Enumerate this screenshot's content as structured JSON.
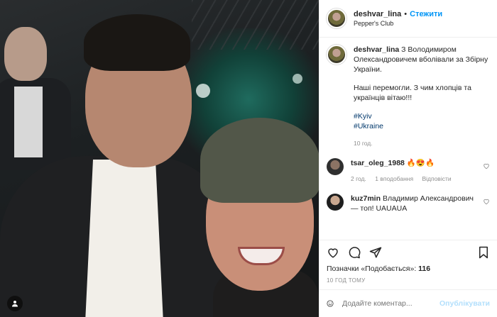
{
  "header": {
    "username": "deshvar_lina",
    "separator": "•",
    "follow_label": "Стежити",
    "location": "Pepper's Club"
  },
  "caption": {
    "username": "deshvar_lina",
    "text1": "З Володимиром Олександровичем вболівали за Збірну України.",
    "text2": "Наші перемогли. З чим хлопців та українців вітаю!!!",
    "hashtags": [
      "#Kyiv",
      "#Ukraine"
    ],
    "time": "10 год."
  },
  "comments": [
    {
      "username": "tsar_oleg_1988",
      "text": "🔥😍🔥",
      "time": "2 год.",
      "likes": "1 вподобання",
      "reply_label": "Відповісти"
    },
    {
      "username": "kuz7min",
      "text": "Владимир Александрович — топ! UAUAUA"
    }
  ],
  "actions": {
    "likes_label": "Позначки «Подобається»:",
    "likes_count": "116",
    "time_ago": "10 ГОД ТОМУ"
  },
  "add_comment": {
    "placeholder": "Додайте коментар...",
    "publish_label": "Опублікувати"
  },
  "icons": [
    "heart-icon",
    "comment-icon",
    "share-icon",
    "bookmark-icon",
    "emoji-icon",
    "tag-person-icon"
  ],
  "colors": {
    "link": "#0095f6",
    "hashtag": "#00376b",
    "muted": "#8e8e8e",
    "publish_disabled": "#b2dffc"
  }
}
